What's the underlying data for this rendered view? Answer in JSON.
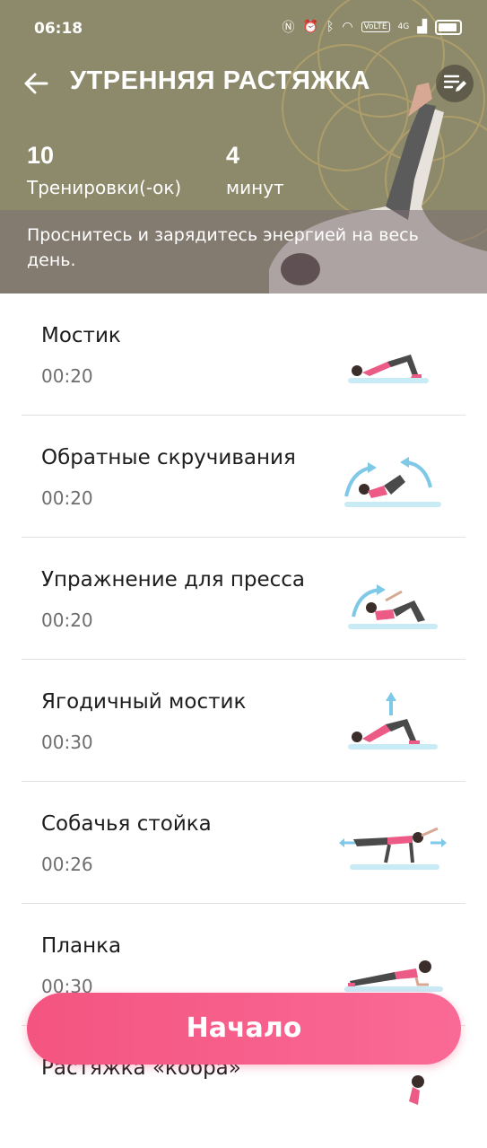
{
  "status_bar": {
    "time": "06:18",
    "icons": [
      "nfc-icon",
      "alarm-icon",
      "bluetooth-icon",
      "wifi-icon",
      "volte-icon",
      "signal-icon",
      "battery-icon"
    ],
    "volte": "VoLTE",
    "network": "4G"
  },
  "header": {
    "title": "УТРЕННЯЯ РАСТЯЖКА",
    "stats": [
      {
        "value": "10",
        "label": "Тренировки(-ок)"
      },
      {
        "value": "4",
        "label": "минут"
      }
    ],
    "description": "Проснитесь и зарядитесь энергией на весь день."
  },
  "exercises": [
    {
      "name": "Мостик",
      "duration": "00:20"
    },
    {
      "name": "Обратные скручивания",
      "duration": "00:20"
    },
    {
      "name": "Упражнение для пресса",
      "duration": "00:20"
    },
    {
      "name": "Ягодичный мостик",
      "duration": "00:30"
    },
    {
      "name": "Собачья стойка",
      "duration": "00:26"
    },
    {
      "name": "Планка",
      "duration": "00:30"
    },
    {
      "name": "Растяжка «кобра»",
      "duration": ""
    }
  ],
  "start_button": {
    "label": "Начало"
  },
  "colors": {
    "accent": "#f45480",
    "hero_bg": "#8c8a6a"
  }
}
